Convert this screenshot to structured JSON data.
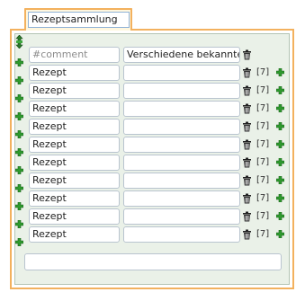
{
  "tab": {
    "label": "Rezeptsammlung"
  },
  "header_row": {
    "comment_placeholder": "#comment",
    "value": "Verschiedene bekannte Gerichte"
  },
  "rows": [
    {
      "name": "Rezept",
      "value": "",
      "count": "[7]"
    },
    {
      "name": "Rezept",
      "value": "",
      "count": "[7]"
    },
    {
      "name": "Rezept",
      "value": "",
      "count": "[7]"
    },
    {
      "name": "Rezept",
      "value": "",
      "count": "[7]"
    },
    {
      "name": "Rezept",
      "value": "",
      "count": "[7]"
    },
    {
      "name": "Rezept",
      "value": "",
      "count": "[7]"
    },
    {
      "name": "Rezept",
      "value": "",
      "count": "[7]"
    },
    {
      "name": "Rezept",
      "value": "",
      "count": "[7]"
    },
    {
      "name": "Rezept",
      "value": "",
      "count": "[7]"
    },
    {
      "name": "Rezept",
      "value": "",
      "count": "[7]"
    }
  ],
  "bottom_input": {
    "value": ""
  },
  "colors": {
    "accent_orange": "#f3b15e",
    "panel_green": "#eaf1e8",
    "plus_green": "#2e9a2e"
  },
  "icons": {
    "delete": "trash-icon",
    "add": "plus-icon",
    "move": "move-icon"
  }
}
